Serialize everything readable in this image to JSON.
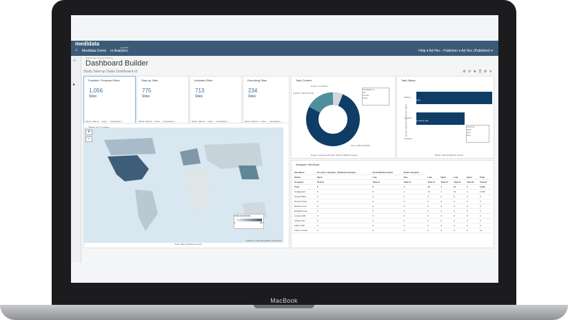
{
  "device": {
    "brand": "MacBook"
  },
  "header": {
    "logo": "medidata",
    "study": "Medidata Demo",
    "app": "rn Analytics",
    "autohide": "autohide",
    "right_links": "Help ▾   Ad Hoc - Publisher ▾   Ad Hoc (Publisher) ▾"
  },
  "page": {
    "breadcrumb": "Dashboards / Study / Start-up",
    "title": "Dashboard Builder",
    "subtitle": "Study Start-up Tasks Dashboard v2"
  },
  "kpis": [
    {
      "title": "Feasible / Proposed Sites",
      "value": "1,056",
      "unit": "Sites",
      "foot": "Metric: Task Id ... Color: ... Comparison: ..."
    },
    {
      "title": "Start-up Sites",
      "value": "775",
      "unit": "Sites",
      "foot": "Metric: Task Id ... Color: ... Comparison: ..."
    },
    {
      "title": "Activated Sites",
      "value": "713",
      "unit": "Sites",
      "foot": "Metric: Task Id ... Color: ... Comparison: ..."
    },
    {
      "title": "Recruiting Sites",
      "value": "234",
      "unit": "Sites",
      "foot": "Metric: Task Id ... Color: ... Comparison: ..."
    }
  ],
  "map_panel": {
    "title": "Tasks by Country",
    "legend_title": "TASK ID (DISTIN...",
    "legend_max": "657",
    "legend_min": "1",
    "attribution": "Leaflet | © OpenStreetMap contributors",
    "footer": "Color: Task Id (Distinct Count)"
  },
  "context_panel": {
    "title": "Task Context",
    "legend_title": "CONTEXT C...",
    "legend_items": [
      "site",
      "country",
      "study"
    ],
    "slice_labels": [
      "study | 71 (5.81%)",
      "country | 196 (15.41%)",
      "site | 1,005 (79.09%)"
    ],
    "footer": "Group: Context Code  Size: Task Id (Distinct Count)"
  },
  "status_panel": {
    "title": "Task Status",
    "y_label": "Group: Lifecycle  Sub-Group: Status",
    "rows": [
      "Startup",
      "Conduct",
      "Closeout"
    ],
    "bar_labels": [
      "Late",
      "Conduct Late"
    ],
    "legend_title": "STATUS",
    "legend_items": [
      "Open",
      "Late",
      "Due"
    ],
    "x_ticks": [
      "0",
      "200",
      "400",
      "600",
      "800",
      "1k",
      "1.2"
    ],
    "footer": "Metric: Task Id (Distinct Count)"
  },
  "workload_panel": {
    "title": "Assignee Workload",
    "groups": [
      "Site Name",
      "St. Luke's Hospital - Allentown Campus",
      "Scott Medical Center",
      "Bonus Hospital"
    ],
    "statuses": [
      "Status",
      "Open",
      "Late",
      "Due",
      "Late",
      "Open",
      "Late",
      "Open",
      "Total"
    ],
    "rows": [
      [
        "Assignee",
        "Task Id",
        "Task Id",
        "Task Id",
        "Task Id",
        "Task Id",
        "Task Id",
        "Task Id",
        "Task Id"
      ],
      [
        "Total",
        "5",
        "5",
        "1",
        "12",
        "1",
        "57",
        "1",
        "1,056"
      ],
      [
        "Unassigned",
        "5",
        "5",
        "1",
        "12",
        "1",
        "31",
        "1",
        "1,056"
      ],
      [
        "Kevelin Bath...",
        "0",
        "0",
        "0",
        "0",
        "0",
        "0",
        "0",
        "6"
      ],
      [
        "Terrace Smig...",
        "0",
        "0",
        "0",
        "0",
        "0",
        "0",
        "0",
        "5"
      ],
      [
        "Rachel Conn...",
        "0",
        "0",
        "0",
        "0",
        "0",
        "0",
        "0",
        "4"
      ],
      [
        "Elizabeth Lak...",
        "0",
        "0",
        "0",
        "0",
        "0",
        "0",
        "0",
        "3"
      ],
      [
        "Lourde CRK",
        "0",
        "0",
        "0",
        "0",
        "0",
        "0",
        "0",
        "2"
      ],
      [
        "Andrew Fth...",
        "0",
        "0",
        "0",
        "0",
        "0",
        "0",
        "0",
        "5"
      ],
      [
        "Adam CDP",
        "0",
        "0",
        "0",
        "0",
        "0",
        "0",
        "0",
        "3"
      ],
      [
        "Thorin 2-2 MC",
        "0",
        "0",
        "0",
        "0",
        "0",
        "0",
        "0",
        "11"
      ]
    ]
  },
  "colors": {
    "topbar": "#3c5a78",
    "accent": "#2f6fa7",
    "dark_blue": "#0f3d66",
    "mid_teal": "#4f8f9b",
    "light_gray": "#d6d8db"
  }
}
